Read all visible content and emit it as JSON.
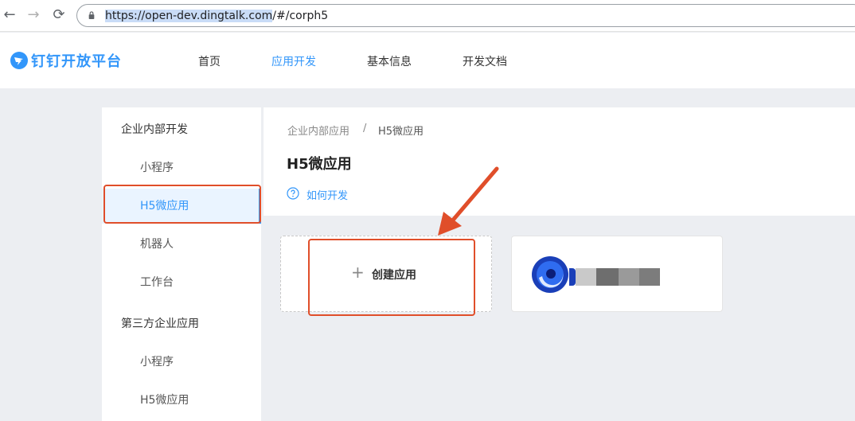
{
  "browser": {
    "url_selected": "https://open-dev.dingtalk.com",
    "url_rest": "/#/corph5",
    "back": "←",
    "forward": "→",
    "reload": "⟳"
  },
  "header": {
    "logo_text": "钉钉开放平台",
    "nav": [
      {
        "label": "首页"
      },
      {
        "label": "应用开发",
        "active": true
      },
      {
        "label": "基本信息"
      },
      {
        "label": "开发文档"
      }
    ]
  },
  "sidebar": {
    "group1": "企业内部开发",
    "group1_items": [
      {
        "label": "小程序"
      },
      {
        "label": "H5微应用",
        "active": true
      },
      {
        "label": "机器人"
      },
      {
        "label": "工作台"
      }
    ],
    "group2": "第三方企业应用",
    "group2_items": [
      {
        "label": "小程序"
      },
      {
        "label": "H5微应用"
      }
    ]
  },
  "main": {
    "breadcrumb_parent": "企业内部应用",
    "breadcrumb_sep": "/",
    "breadcrumb_current": "H5微应用",
    "title": "H5微应用",
    "help_link": "如何开发",
    "create_plus": "+",
    "create_label": "创建应用"
  },
  "colors": {
    "accent": "#3296fa",
    "annotation": "#e04e2a"
  }
}
